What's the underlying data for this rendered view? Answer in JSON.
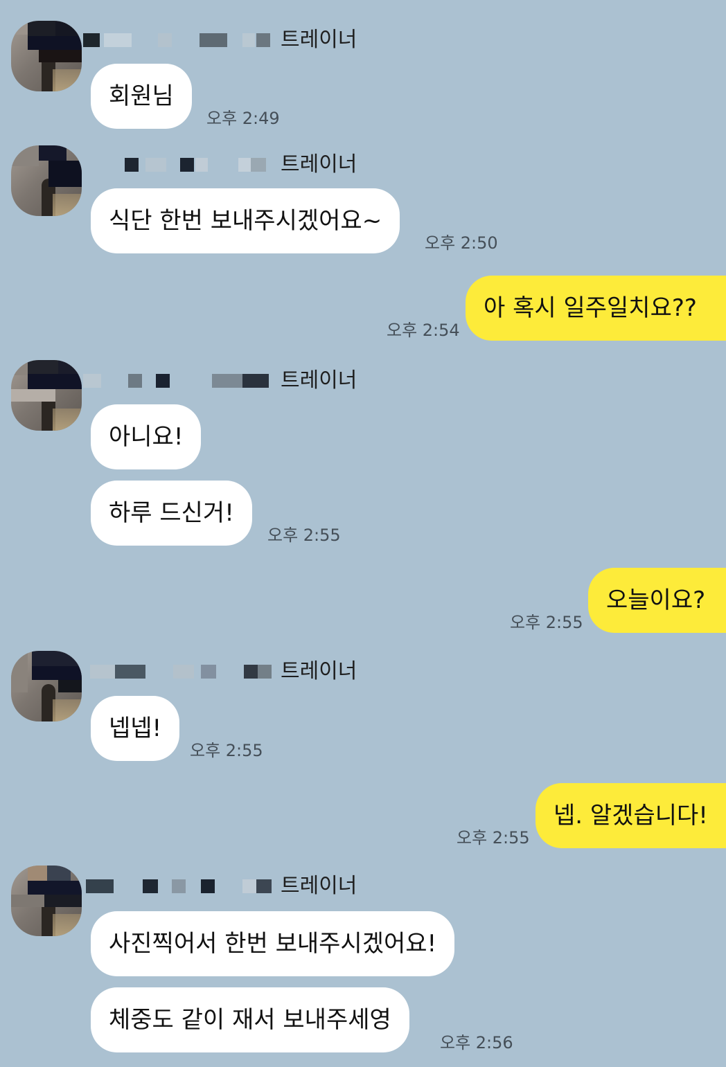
{
  "colors": {
    "background": "#abc1d1",
    "incoming_bubble": "#ffffff",
    "outgoing_bubble": "#fdeb3a",
    "time_text": "#454f58"
  },
  "messages": {
    "g1": {
      "sender_role": "트레이너",
      "m1": "회원님",
      "time": "오후 2:49"
    },
    "g2": {
      "sender_role": "트레이너",
      "m1": "식단 한번 보내주시겠어요~",
      "time": "오후 2:50"
    },
    "o1": {
      "text": "아 혹시 일주일치요??",
      "time": "오후 2:54"
    },
    "g3": {
      "sender_role": "트레이너",
      "m1": "아니요!",
      "m2": "하루 드신거!",
      "time": "오후 2:55"
    },
    "o2": {
      "text": "오늘이요?",
      "time": "오후 2:55"
    },
    "g4": {
      "sender_role": "트레이너",
      "m1": "넵넵!",
      "time": "오후 2:55"
    },
    "o3": {
      "text": "넵. 알겠습니다!",
      "time": "오후 2:55"
    },
    "g5": {
      "sender_role": "트레이너",
      "m1": "사진찍어서 한번 보내주시겠어요!",
      "m2": "체중도 같이 재서 보내주세영",
      "time": "오후 2:56"
    }
  }
}
